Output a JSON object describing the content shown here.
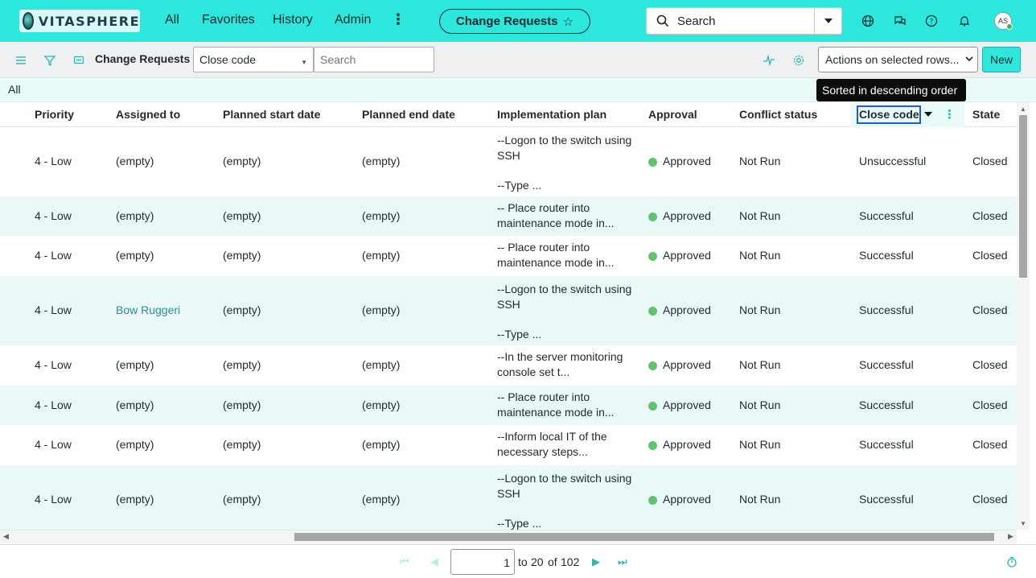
{
  "brand": {
    "name": "VITASPHERE"
  },
  "nav": {
    "links": [
      "All",
      "Favorites",
      "History",
      "Admin"
    ],
    "current_app": "Change Requests",
    "search_placeholder": "Search",
    "avatar_initials": "AS"
  },
  "toolbar": {
    "list_title": "Change Requests",
    "filter_field": "Close code",
    "search_placeholder": "Search",
    "actions_label": "Actions on selected rows...",
    "new_label": "New"
  },
  "breadcrumb": {
    "root": "All"
  },
  "tooltip": "Sorted in descending order",
  "columns": [
    "Priority",
    "Assigned to",
    "Planned start date",
    "Planned end date",
    "Implementation plan",
    "Approval",
    "Conflict status",
    "Close code",
    "State"
  ],
  "sort": {
    "column": "Close code",
    "direction": "descending"
  },
  "rows": [
    {
      "priority": "4 - Low",
      "assigned_to": "(empty)",
      "start": "(empty)",
      "end": "(empty)",
      "plan": "--Logon to the switch using SSH",
      "plan_extra": "--Type ...",
      "approval": "Approved",
      "conflict": "Not Run",
      "close_code": "Unsuccessful",
      "state": "Closed"
    },
    {
      "priority": "4 - Low",
      "assigned_to": "(empty)",
      "start": "(empty)",
      "end": "(empty)",
      "plan": "-- Place router into maintenance mode in...",
      "plan_extra": "",
      "approval": "Approved",
      "conflict": "Not Run",
      "close_code": "Successful",
      "state": "Closed"
    },
    {
      "priority": "4 - Low",
      "assigned_to": "(empty)",
      "start": "(empty)",
      "end": "(empty)",
      "plan": "-- Place router into maintenance mode in...",
      "plan_extra": "",
      "approval": "Approved",
      "conflict": "Not Run",
      "close_code": "Successful",
      "state": "Closed"
    },
    {
      "priority": "4 - Low",
      "assigned_to": "Bow Ruggeri",
      "start": "(empty)",
      "end": "(empty)",
      "plan": "--Logon to the switch using SSH",
      "plan_extra": "--Type ...",
      "approval": "Approved",
      "conflict": "Not Run",
      "close_code": "Successful",
      "state": "Closed"
    },
    {
      "priority": "4 - Low",
      "assigned_to": "(empty)",
      "start": "(empty)",
      "end": "(empty)",
      "plan": "--In the server monitoring console set t...",
      "plan_extra": "",
      "approval": "Approved",
      "conflict": "Not Run",
      "close_code": "Successful",
      "state": "Closed"
    },
    {
      "priority": "4 - Low",
      "assigned_to": "(empty)",
      "start": "(empty)",
      "end": "(empty)",
      "plan": "-- Place router into maintenance mode in...",
      "plan_extra": "",
      "approval": "Approved",
      "conflict": "Not Run",
      "close_code": "Successful",
      "state": "Closed"
    },
    {
      "priority": "4 - Low",
      "assigned_to": "(empty)",
      "start": "(empty)",
      "end": "(empty)",
      "plan": "--Inform local IT of the necessary steps...",
      "plan_extra": "",
      "approval": "Approved",
      "conflict": "Not Run",
      "close_code": "Successful",
      "state": "Closed"
    },
    {
      "priority": "4 - Low",
      "assigned_to": "(empty)",
      "start": "(empty)",
      "end": "(empty)",
      "plan": "--Logon to the switch using SSH",
      "plan_extra": "--Type ...",
      "approval": "Approved",
      "conflict": "Not Run",
      "close_code": "Successful",
      "state": "Closed"
    }
  ],
  "pager": {
    "current": "1",
    "range_end": "20",
    "total": "102",
    "to_label": "to",
    "of_label": "of"
  },
  "colors": {
    "accent": "#2ce8dc",
    "row_alt": "#eaf9f7",
    "approved": "#5fc46b",
    "link": "#2a8b9a"
  }
}
